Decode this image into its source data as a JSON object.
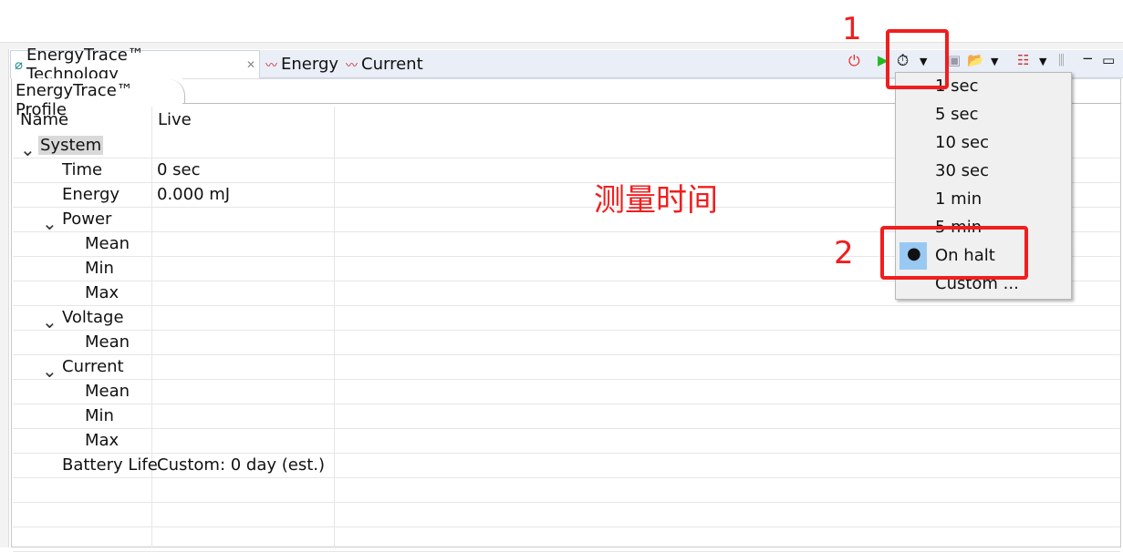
{
  "tabs": [
    {
      "label": "EnergyTrace™ Technology",
      "icon": "energytrace-icon",
      "close": "✕"
    },
    {
      "label": "Energy",
      "icon": "chart-icon"
    },
    {
      "label": "Current",
      "icon": "chart-icon"
    }
  ],
  "subtab": "EnergyTrace™ Profile",
  "columns": [
    "Name",
    "Live"
  ],
  "rows": [
    {
      "name": "System",
      "value": "",
      "level": 0,
      "expandable": true
    },
    {
      "name": "Time",
      "value": "0 sec",
      "level": 1
    },
    {
      "name": "Energy",
      "value": "0.000 mJ",
      "level": 1
    },
    {
      "name": "Power",
      "value": "",
      "level": 1,
      "expandable": true
    },
    {
      "name": "Mean",
      "value": "",
      "level": 2
    },
    {
      "name": "Min",
      "value": "",
      "level": 2
    },
    {
      "name": "Max",
      "value": "",
      "level": 2
    },
    {
      "name": "Voltage",
      "value": "",
      "level": 1,
      "expandable": true
    },
    {
      "name": "Mean",
      "value": "",
      "level": 2
    },
    {
      "name": "Current",
      "value": "",
      "level": 1,
      "expandable": true
    },
    {
      "name": "Mean",
      "value": "",
      "level": 2
    },
    {
      "name": "Min",
      "value": "",
      "level": 2
    },
    {
      "name": "Max",
      "value": "",
      "level": 2
    },
    {
      "name": "Battery Life",
      "value": "Custom: 0 day (est.)",
      "level": 1
    }
  ],
  "menu": {
    "items": [
      "1 sec",
      "5 sec",
      "10 sec",
      "30 sec",
      "1 min",
      "5 min",
      "On halt",
      "Custom ..."
    ],
    "selected": "On halt"
  },
  "annotations": {
    "label1": "1",
    "label2": "2",
    "note": "测量时间",
    "color": "#f01e1e"
  }
}
